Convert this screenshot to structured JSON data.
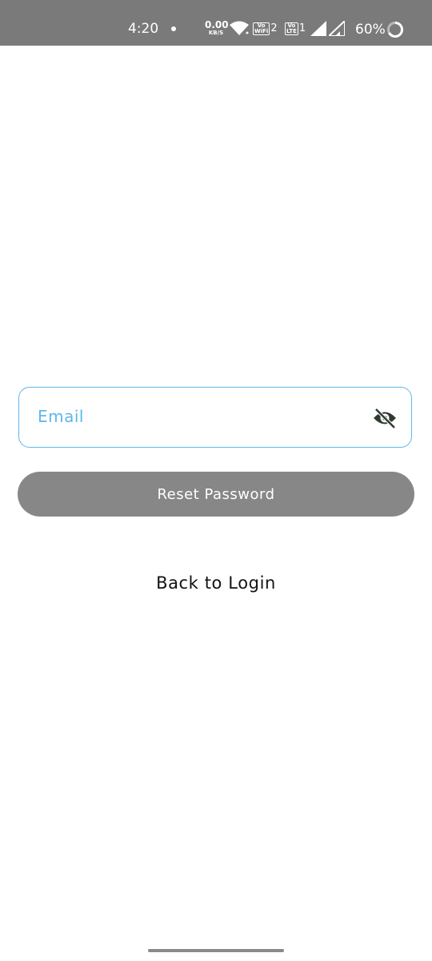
{
  "status_bar": {
    "time": "4:20",
    "net_speed_value": "0.00",
    "net_speed_unit": "KB/S",
    "sim2_badge_top": "Vo",
    "sim2_badge_bottom": "WiFi",
    "sim2_number": "2",
    "sim1_badge_top": "Vo",
    "sim1_badge_bottom": "LTE",
    "sim1_number": "1",
    "battery_percent": "60%",
    "icons": [
      "wifi-icon",
      "signal-icon",
      "battery-icon"
    ]
  },
  "form": {
    "email_placeholder": "Email",
    "visibility_icon": "eye-off-icon",
    "reset_button_label": "Reset Password",
    "back_to_login_label": "Back to Login"
  },
  "colors": {
    "accent": "#5db8e8",
    "button_disabled": "#878787",
    "status_bar": "#7a7a7a"
  }
}
